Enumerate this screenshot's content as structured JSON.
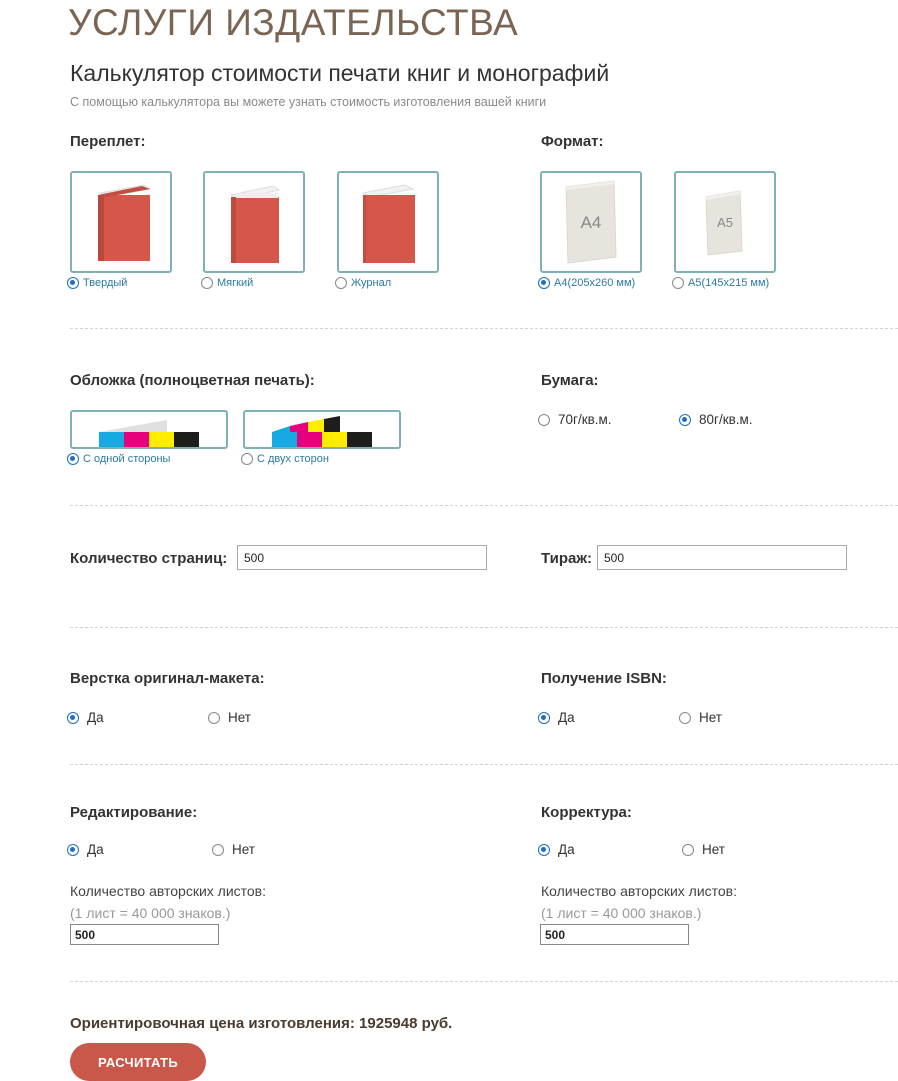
{
  "header": {
    "title": "УСЛУГИ ИЗДАТЕЛЬСТВА",
    "subtitle": "Калькулятор стоимости печати книг и монографий",
    "description": "С помощью калькулятора вы можете узнать стоимость изготовления вашей книги"
  },
  "binding": {
    "label": "Переплет:",
    "options": [
      {
        "label": "Твердый",
        "selected": true
      },
      {
        "label": "Мягкий",
        "selected": false
      },
      {
        "label": "Журнал",
        "selected": false
      }
    ]
  },
  "format": {
    "label": "Формат:",
    "options": [
      {
        "label": "A4(205x260 мм)",
        "card_text": "A4",
        "selected": true
      },
      {
        "label": "A5(145x215 мм)",
        "card_text": "A5",
        "selected": false
      }
    ]
  },
  "cover": {
    "label": "Обложка (полноцветная печать):",
    "options": [
      {
        "label": "С одной стороны",
        "selected": true
      },
      {
        "label": "С двух сторон",
        "selected": false
      }
    ]
  },
  "paper": {
    "label": "Бумага:",
    "options": [
      {
        "label": "70г/кв.м.",
        "selected": false
      },
      {
        "label": "80г/кв.м.",
        "selected": true
      }
    ]
  },
  "pages": {
    "label": "Количество страниц:",
    "value": "500"
  },
  "run": {
    "label": "Тираж:",
    "value": "500"
  },
  "layout": {
    "label": "Верстка оригинал-макета:",
    "options": [
      {
        "label": "Да",
        "selected": true
      },
      {
        "label": "Нет",
        "selected": false
      }
    ]
  },
  "isbn": {
    "label": "Получение ISBN:",
    "options": [
      {
        "label": "Да",
        "selected": true
      },
      {
        "label": "Нет",
        "selected": false
      }
    ]
  },
  "editing": {
    "label": "Редактирование:",
    "options": [
      {
        "label": "Да",
        "selected": true
      },
      {
        "label": "Нет",
        "selected": false
      }
    ],
    "sheets_label": "Количество авторских листов:",
    "sheets_note": "(1 лист = 40 000 знаков.)",
    "sheets_value": "500"
  },
  "proofreading": {
    "label": "Корректура:",
    "options": [
      {
        "label": "Да",
        "selected": true
      },
      {
        "label": "Нет",
        "selected": false
      }
    ],
    "sheets_label": "Количество авторских листов:",
    "sheets_note": "(1 лист = 40 000 знаков.)",
    "sheets_value": "500"
  },
  "result": {
    "text": "Ориентировочная цена изготовления: 1925948 руб."
  },
  "actions": {
    "calculate": "РАСЧИТАТЬ"
  },
  "colors": {
    "accent": "#c9574a",
    "title": "#7a6552",
    "card_border": "#7fb0b8",
    "radio_selected": "#1e6fc0",
    "book_red": "#d4574a",
    "cmyk": [
      "#17a9e1",
      "#e5007e",
      "#ffed00",
      "#1d1d1b"
    ]
  }
}
